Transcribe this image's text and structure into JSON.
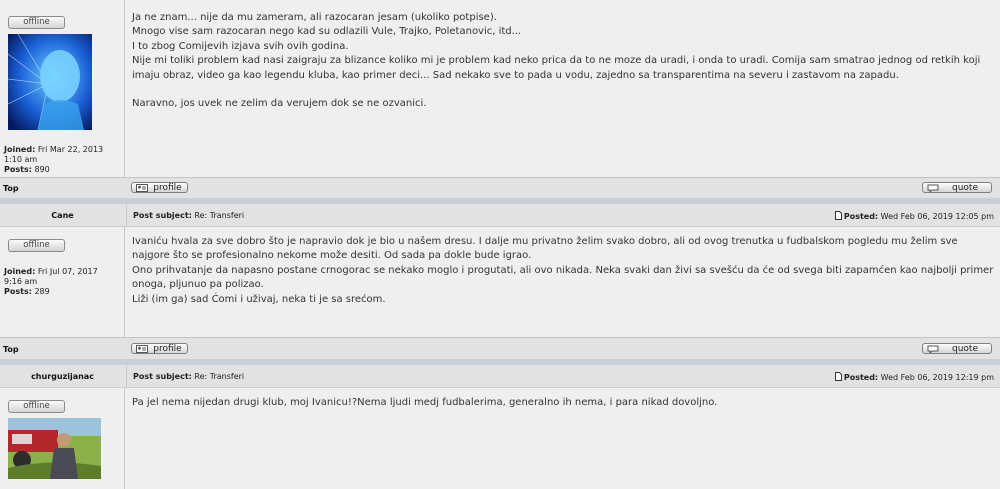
{
  "posts": [
    {
      "status": "offline",
      "joined_label": "Joined:",
      "joined_value": "Fri Mar 22, 2013",
      "joined_time": "1:10 am",
      "posts_label": "Posts:",
      "posts_value": "890",
      "lines": [
        "Ja ne znam... nije da mu zameram, ali razocaran jesam (ukoliko potpise).",
        "Mnogo vise sam razocaran nego kad su odlazili Vule, Trajko, Poletanovic, itd...",
        "I to zbog Comijevih izjava svih ovih godina.",
        "Nije mi toliki problem kad nasi zaigraju za blizance koliko mi je problem kad neko prica da to ne moze da uradi, i onda to uradi. Comija sam smatrao jednog od retkih koji imaju obraz, video ga kao legendu kluba, kao primer deci... Sad nekako sve to pada u vodu, zajedno sa transparentima na severu i zastavom na zapadu.",
        "",
        "Naravno, jos uvek ne zelim da verujem dok se ne ozvanici."
      ],
      "top": "Top",
      "profile": "profile",
      "quote": "quote"
    },
    {
      "author": "Cane",
      "subject_label": "Post subject:",
      "subject": "Re: Transferi",
      "posted_label": "Posted:",
      "posted": "Wed Feb 06, 2019 12:05 pm",
      "status": "offline",
      "joined_label": "Joined:",
      "joined_value": "Fri Jul 07, 2017",
      "joined_time": "9:16 am",
      "posts_label": "Posts:",
      "posts_value": "289",
      "lines": [
        "Ivaniću hvala za sve dobro što je napravio dok je bio u našem dresu. I dalje mu privatno želim svako dobro, ali od ovog trenutka u fudbalskom pogledu mu želim sve najgore što se profesionalno nekome može desiti. Od sada pa dokle bude igrao.",
        "Ono prihvatanje da napasno postane crnogorac se nekako moglo i progutati, ali ovo nikada. Neka svaki dan živi sa svešću da će od svega biti zapamćen kao najbolji primer onoga, pljunuo pa polizao.",
        "Liži (im ga) sad Ćomi i uživaj, neka ti je sa srećom."
      ],
      "top": "Top",
      "profile": "profile",
      "quote": "quote"
    },
    {
      "author": "churguzijanac",
      "subject_label": "Post subject:",
      "subject": "Re: Transferi",
      "posted_label": "Posted:",
      "posted": "Wed Feb 06, 2019 12:19 pm",
      "status": "offline",
      "lines": [
        "Pa jel nema nijedan drugi klub, moj Ivanicu!?Nema ljudi medj fudbalerima, generalno ih nema, i para nikad dovoljno."
      ]
    }
  ],
  "colors": {
    "separator": "#c8cfd6",
    "body": "#efefef",
    "header": "#e2e2e2"
  },
  "icons": {
    "profile": "profile-card-icon",
    "quote": "speech-bubble-icon",
    "posted": "document-icon"
  }
}
